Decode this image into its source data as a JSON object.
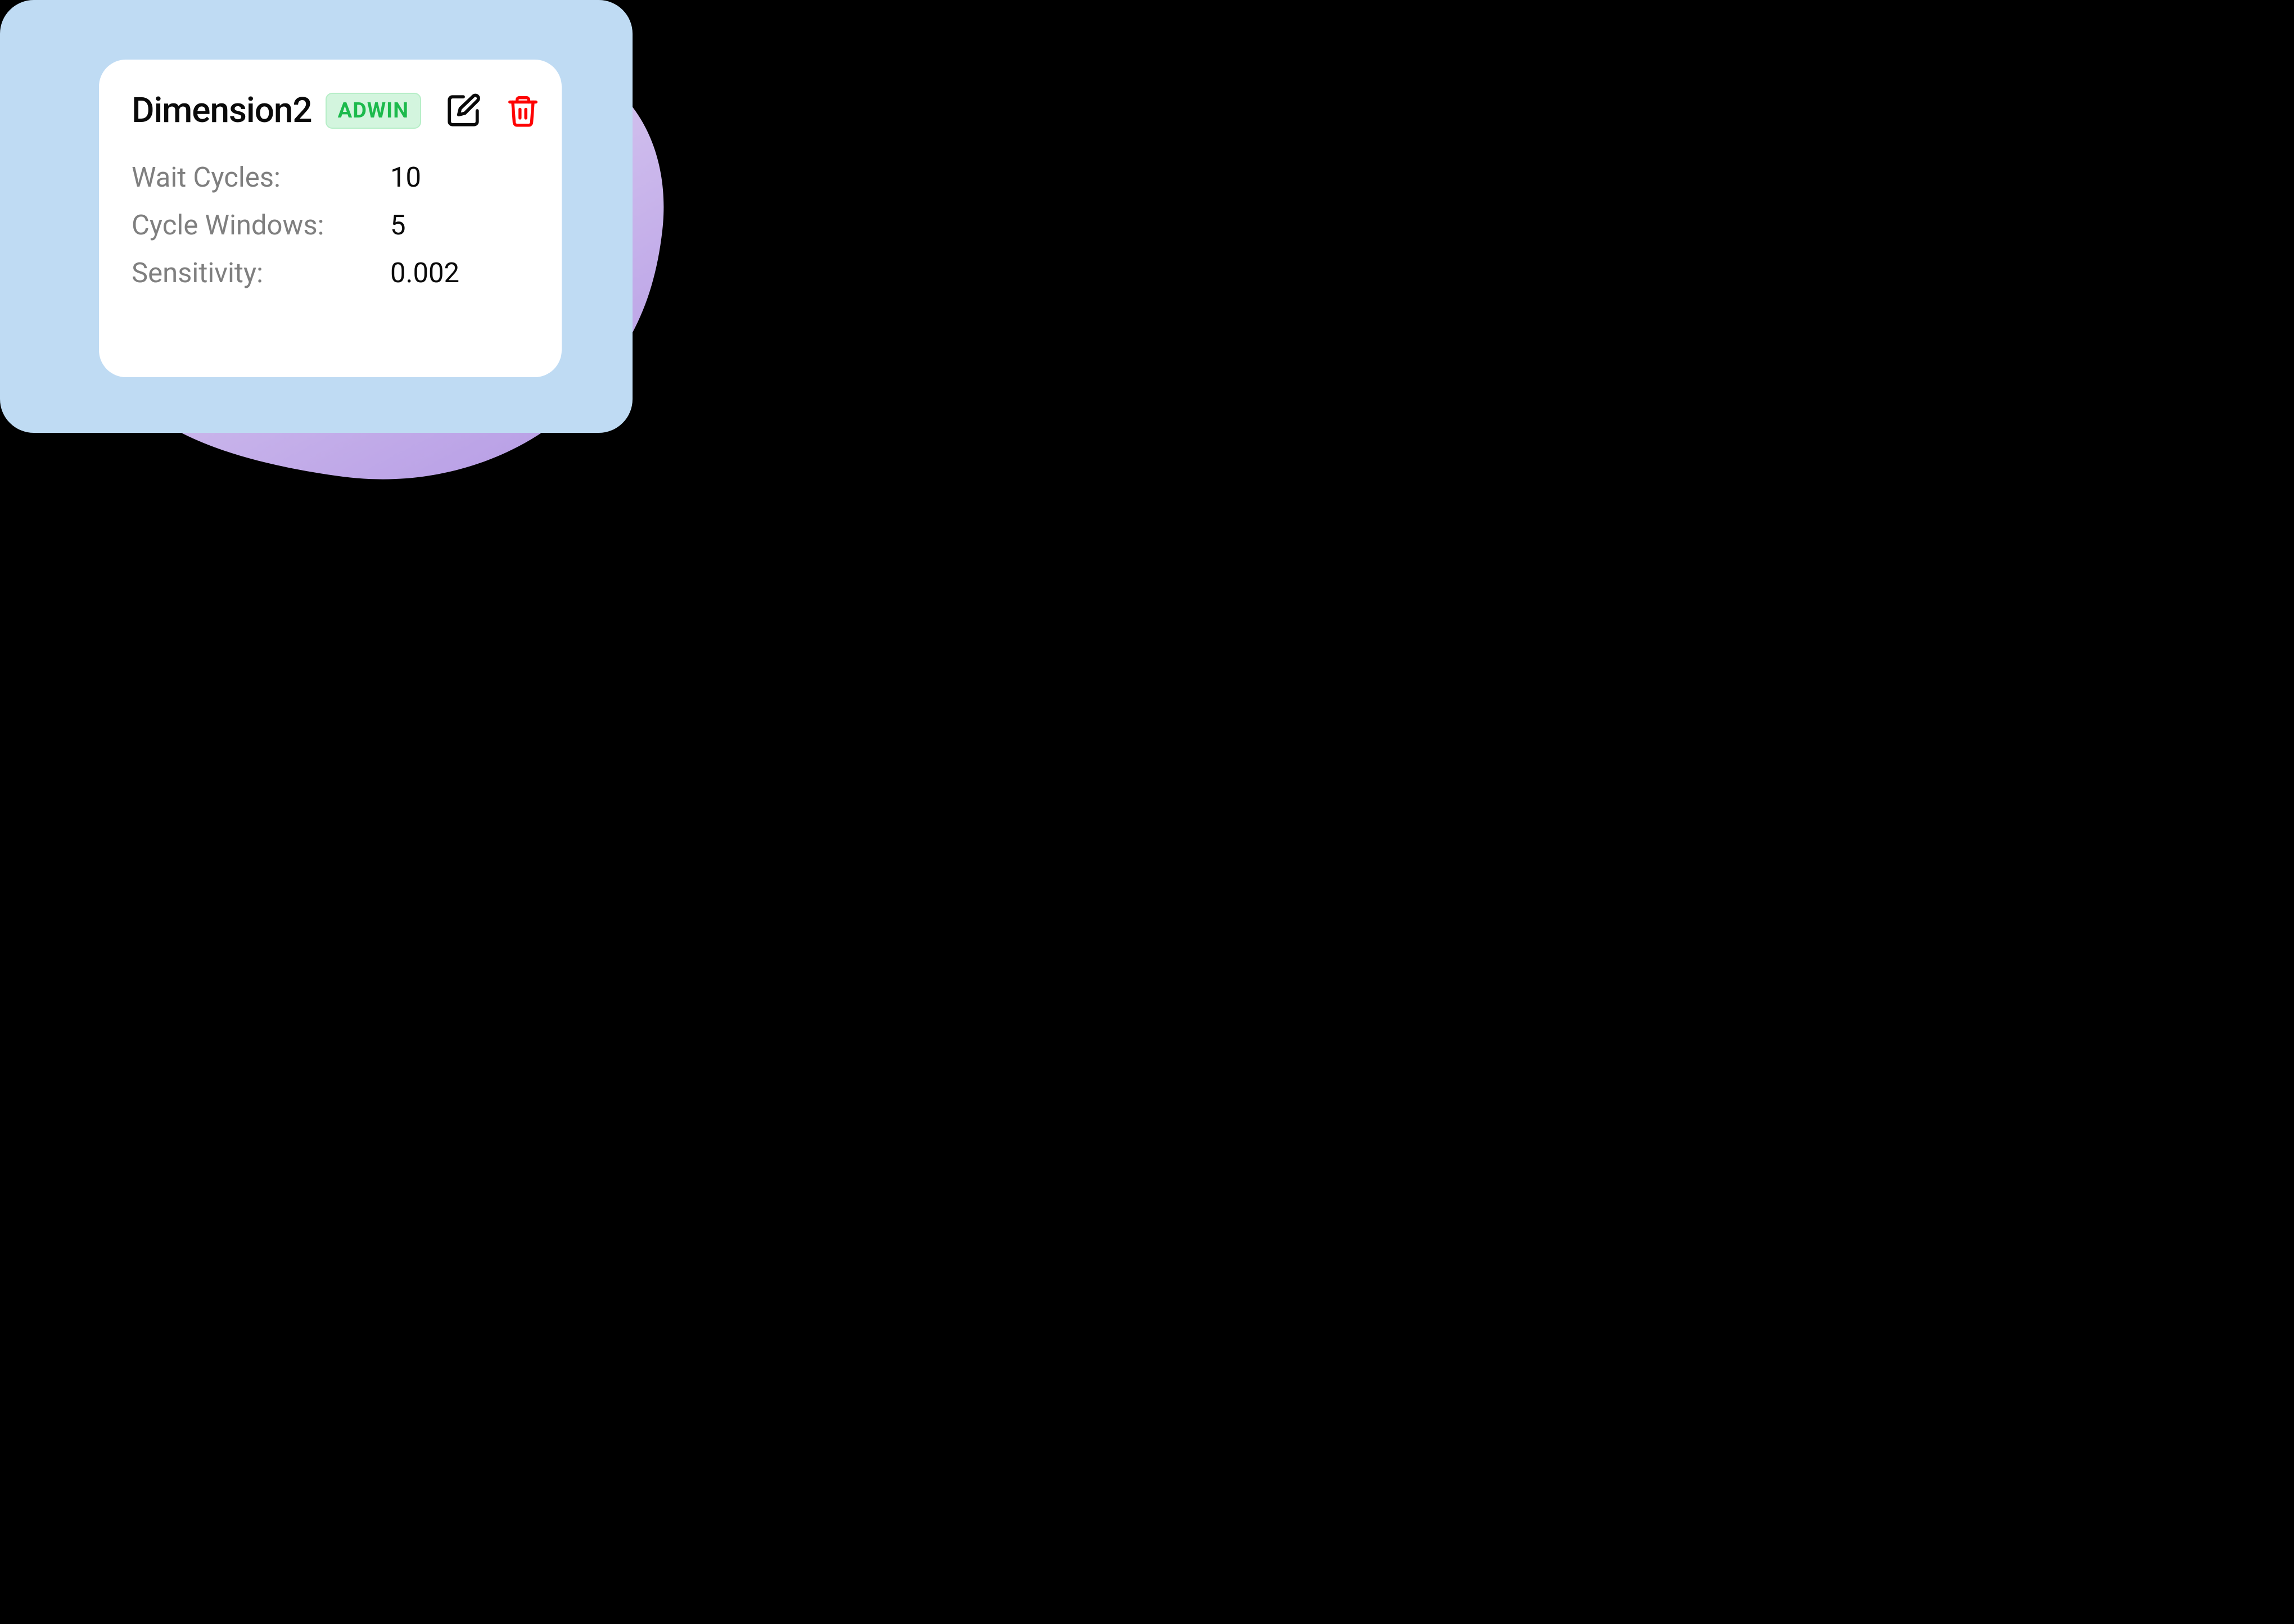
{
  "card": {
    "title": "Dimension2",
    "badge": "ADWIN",
    "params": [
      {
        "label": "Wait Cycles:",
        "value": "10"
      },
      {
        "label": "Cycle Windows:",
        "value": "5"
      },
      {
        "label": "Sensitivity:",
        "value": "0.002"
      }
    ]
  },
  "colors": {
    "panel": "#bfdbf3",
    "badgeBg": "#d3f5de",
    "badgeText": "#1cba4c",
    "trash": "#fe0303",
    "blobLight": "#dfd2f3",
    "blobMid": "#ccb9ed",
    "blobDark": "#bba2e7"
  }
}
